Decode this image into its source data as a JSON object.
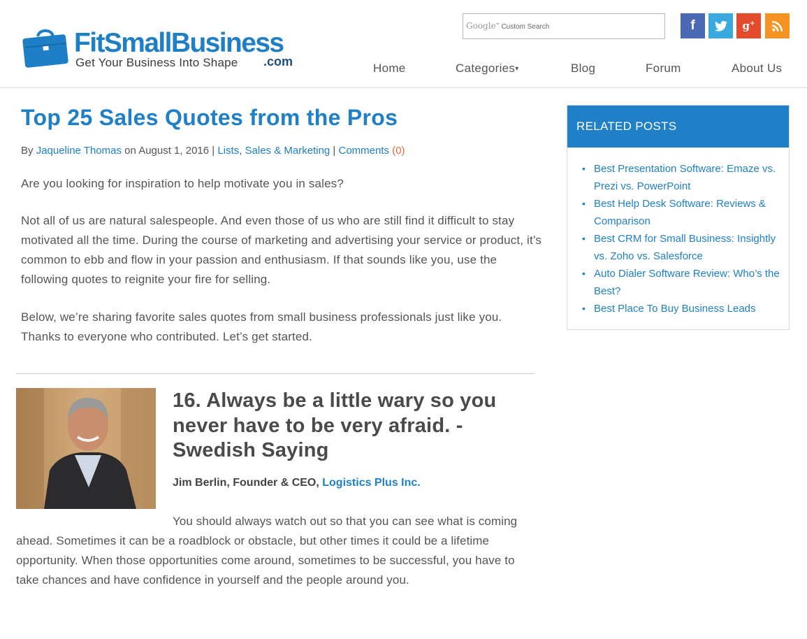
{
  "header": {
    "logo": {
      "name": "FitSmallBusiness",
      "tagline": "Get Your Business Into Shape",
      "suffix": ".com"
    },
    "search": {
      "brand": "Google",
      "placeholder": "Custom Search"
    },
    "social": [
      {
        "icon": "facebook-icon",
        "glyph": "f",
        "color": "#4b68b5"
      },
      {
        "icon": "twitter-icon",
        "glyph": "t",
        "color": "#39a9e0"
      },
      {
        "icon": "google-plus-icon",
        "glyph": "g+",
        "color": "#e44b2c"
      },
      {
        "icon": "rss-icon",
        "glyph": "rss",
        "color": "#f79421"
      }
    ],
    "nav": {
      "home": "Home",
      "categories": "Categories",
      "caret": "▾",
      "blog": "Blog",
      "forum": "Forum",
      "about": "About Us"
    }
  },
  "article": {
    "title": "Top 25 Sales Quotes from the Pros",
    "meta": {
      "by": "By ",
      "author": "Jaqueline Thomas",
      "date": " on August 1, 2016 | ",
      "cat1": "Lists",
      "comma": ", ",
      "cat2": "Sales & Marketing",
      "sep": " | ",
      "comments": "Comments",
      "comment_count": "(0)"
    },
    "paragraphs": [
      "Are you looking for inspiration to help motivate you in sales?",
      "Not all of us are natural salespeople. And even those of us who are still find it difficult to stay motivated all the time. During the course of marketing and advertising your service or product, it’s common to ebb and flow in your passion and enthusiasm. If that sounds like you, use the following quotes to reignite your fire for selling.",
      "Below, we’re sharing favorite sales quotes from small business professionals just like you. Thanks to everyone who contributed. Let’s get started."
    ],
    "quote_item": {
      "heading": "16. Always be a little wary so you never have to be very afraid. -Swedish Saying",
      "author_name": "Jim Berlin, Founder & CEO, ",
      "author_company": "Logistics Plus Inc.",
      "body": "You should always watch out so that you can see what is coming ahead. Sometimes it can be a roadblock or obstacle, but other times it could be a lifetime opportunity. When those opportunities come around, sometimes to be successful, you have to take chances and have confidence in yourself and the people around you."
    }
  },
  "sidebar": {
    "heading": "RELATED POSTS",
    "items": [
      "Best Presentation Software: Emaze vs. Prezi vs. PowerPoint",
      "Best Help Desk Software: Reviews & Comparison",
      "Best CRM for Small Business: Insightly vs. Zoho vs. Salesforce",
      "Auto Dialer Software Review: Who’s the Best?",
      "Best Place To Buy Business Leads"
    ]
  },
  "colors": {
    "brand_blue": "#1f80c7",
    "text": "#555555",
    "accent_orange": "#e56b3c"
  }
}
